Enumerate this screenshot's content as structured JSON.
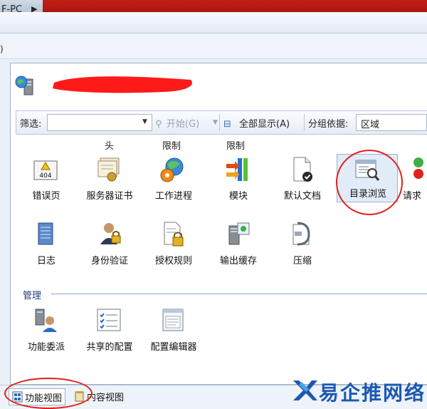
{
  "breadcrumb": {
    "text": "F-PC",
    "arrow": "▶"
  },
  "menu": {
    "text": ")"
  },
  "toolbar": {
    "filter_label": "筛选:",
    "start_label": "开始(G)",
    "show_all_label": "全部显示(A)",
    "group_by_label": "分组依据:",
    "group_by_value": "区域"
  },
  "section_headers": [
    "头",
    "限制",
    "限制"
  ],
  "features_row1": [
    {
      "label": "错误页",
      "icon": "error-page-404-icon"
    },
    {
      "label": "服务器证书",
      "icon": "server-certificate-icon"
    },
    {
      "label": "工作进程",
      "icon": "worker-process-icon"
    },
    {
      "label": "模块",
      "icon": "modules-icon"
    },
    {
      "label": "默认文档",
      "icon": "default-document-icon"
    },
    {
      "label": "目录浏览",
      "icon": "directory-browsing-icon"
    },
    {
      "label": "请求",
      "icon": "request-filtering-icon"
    }
  ],
  "features_row2": [
    {
      "label": "日志",
      "icon": "logging-icon"
    },
    {
      "label": "身份验证",
      "icon": "authentication-icon"
    },
    {
      "label": "授权规则",
      "icon": "authorization-rules-icon"
    },
    {
      "label": "输出缓存",
      "icon": "output-caching-icon"
    },
    {
      "label": "压缩",
      "icon": "compression-icon"
    }
  ],
  "management": {
    "title": "管理",
    "items": [
      {
        "label": "功能委派",
        "icon": "feature-delegation-icon"
      },
      {
        "label": "共享的配置",
        "icon": "shared-configuration-icon"
      },
      {
        "label": "配置编辑器",
        "icon": "configuration-editor-icon"
      }
    ]
  },
  "bottom": {
    "features_view": "功能视图",
    "content_view": "内容视图"
  },
  "brand": {
    "text": "易企推网络"
  },
  "colors": {
    "accent": "#1c58b0",
    "annotation": "#e0201c",
    "redaction": "#ff1a1a"
  }
}
